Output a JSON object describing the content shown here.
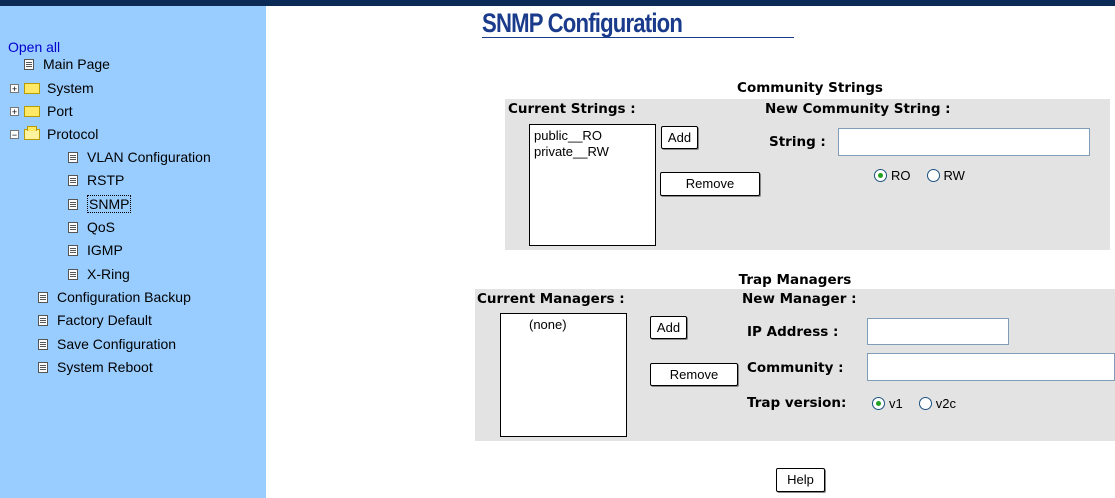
{
  "sidebar": {
    "open_all": "Open all",
    "items": [
      {
        "label": "Main Page",
        "type": "page"
      },
      {
        "label": "System",
        "type": "folder",
        "expander": "+"
      },
      {
        "label": "Port",
        "type": "folder",
        "expander": "+"
      },
      {
        "label": "Protocol",
        "type": "folder-open",
        "expander": "−"
      },
      {
        "label": "VLAN Configuration",
        "type": "page"
      },
      {
        "label": "RSTP",
        "type": "page"
      },
      {
        "label": "SNMP",
        "type": "page",
        "selected": true
      },
      {
        "label": "QoS",
        "type": "page"
      },
      {
        "label": "IGMP",
        "type": "page"
      },
      {
        "label": "X-Ring",
        "type": "page"
      },
      {
        "label": "Configuration Backup",
        "type": "page"
      },
      {
        "label": "Factory Default",
        "type": "page"
      },
      {
        "label": "Save Configuration",
        "type": "page"
      },
      {
        "label": "System Reboot",
        "type": "page"
      }
    ]
  },
  "page": {
    "title": "SNMP Configuration"
  },
  "community": {
    "section_title": "Community Strings",
    "current_label": "Current Strings :",
    "current_items": [
      "public__RO",
      "private__RW"
    ],
    "add_label": "Add",
    "remove_label": "Remove",
    "new_label": "New Community String :",
    "string_label": "String :",
    "string_value": "",
    "access_options": [
      "RO",
      "RW"
    ],
    "access_selected": "RO"
  },
  "trap": {
    "section_title": "Trap Managers",
    "current_label": "Current Managers :",
    "current_items": [
      "(none)"
    ],
    "add_label": "Add",
    "remove_label": "Remove",
    "new_label": "New Manager :",
    "ip_label": "IP Address :",
    "ip_value": "",
    "community_label": "Community :",
    "community_value": "",
    "version_label": "Trap version:",
    "version_options": [
      "v1",
      "v2c"
    ],
    "version_selected": "v1"
  },
  "help_label": "Help",
  "colors": {
    "sidebar_bg": "#99ccff",
    "title_color": "#1a3a8c",
    "panel_bg": "#e3e3e3",
    "topbar": "#0b2a55"
  }
}
